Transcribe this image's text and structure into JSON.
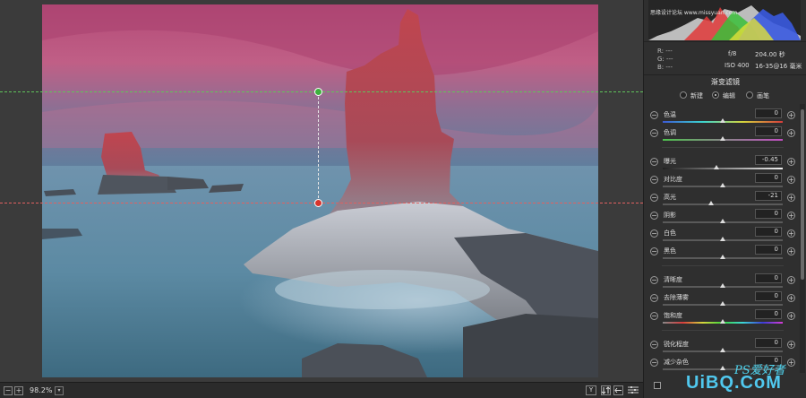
{
  "statusbar": {
    "zoom_minus": "−",
    "zoom_plus": "+",
    "zoom_value": "98.2%",
    "zoom_dropdown": "▾",
    "btn_y": "Y"
  },
  "histogram": {
    "watermark": "思缘设计论坛 www.missyuan.com"
  },
  "meta": {
    "r": "R:   ---",
    "g": "G:   ---",
    "b": "B:   ---",
    "fstop": "f/8",
    "shutter": "204.00 秒",
    "iso": "ISO 400",
    "lens": "16-35@16 毫米"
  },
  "tool": {
    "title": "渐变滤镜",
    "modes": [
      "新建",
      "编辑",
      "画笔"
    ],
    "selected_mode": "编辑"
  },
  "sliders": [
    {
      "label": "色温",
      "value": "0",
      "level": 0.5,
      "track": "hue"
    },
    {
      "label": "色调",
      "value": "0",
      "level": 0.5,
      "track": "tint"
    },
    {
      "label": "曝光",
      "value": "-0.45",
      "level": 0.45,
      "track": "grey"
    },
    {
      "label": "对比度",
      "value": "0",
      "level": 0.5,
      "track": "plain"
    },
    {
      "label": "高光",
      "value": "-21",
      "level": 0.4,
      "track": "plain"
    },
    {
      "label": "阴影",
      "value": "0",
      "level": 0.5,
      "track": "plain"
    },
    {
      "label": "白色",
      "value": "0",
      "level": 0.5,
      "track": "plain"
    },
    {
      "label": "黑色",
      "value": "0",
      "level": 0.5,
      "track": "plain"
    },
    {
      "label": "清晰度",
      "value": "0",
      "level": 0.5,
      "track": "plain"
    },
    {
      "label": "去除薄雾",
      "value": "0",
      "level": 0.5,
      "track": "plain"
    },
    {
      "label": "饱和度",
      "value": "0",
      "level": 0.5,
      "track": "sat"
    },
    {
      "label": "锐化程度",
      "value": "0",
      "level": 0.5,
      "track": "plain"
    },
    {
      "label": "减少杂色",
      "value": "0",
      "level": 0.5,
      "track": "plain"
    }
  ],
  "watermark": {
    "ps_text": "PS爱好者",
    "site": "UiBQ.CoM"
  },
  "colors": {
    "guide_start": "#5fc35a",
    "guide_end": "#e06060",
    "panel_bg": "#2f2f2f"
  }
}
